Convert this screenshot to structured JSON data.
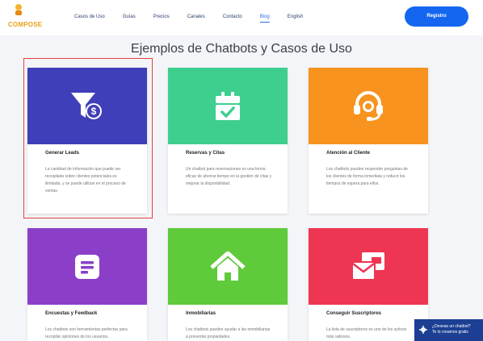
{
  "brand": {
    "name": "COMPOSE"
  },
  "nav": {
    "items": [
      {
        "label": "Casos de Uso",
        "active": false
      },
      {
        "label": "Guías",
        "active": false
      },
      {
        "label": "Precios",
        "active": false
      },
      {
        "label": "Canales",
        "active": false
      },
      {
        "label": "Contacto",
        "active": false
      },
      {
        "label": "Blog",
        "active": true
      },
      {
        "label": "English",
        "active": false
      }
    ],
    "cta_label": "Registro"
  },
  "section": {
    "title": "Ejemplos de Chatbots y Casos de Uso"
  },
  "cards": [
    {
      "title": "Generar Leads",
      "text": "La cantidad de información que puede ser recopilada sobre clientes potenciales es ilimitada, y se puede utilizar en el proceso de ventas.",
      "color": "#3f3fb9",
      "icon": "funnel-dollar-icon"
    },
    {
      "title": "Reservas y Citas",
      "text": "Un chatbot para reservaciones es una forma eficaz de ahorrar tiempo en la gestión de citas y mejorar la disponibilidad.",
      "color": "#3ecf8e",
      "icon": "calendar-check-icon"
    },
    {
      "title": "Atención al Cliente",
      "text": "Los chatbots pueden responder preguntas de los clientes de forma inmediata y reducir los tiempos de espera para ellos.",
      "color": "#f7931e",
      "icon": "headset-icon"
    },
    {
      "title": "Encuestas y Feedback",
      "text": "Los chatbots son herramientas perfectas para recopilar opiniones de los usuarios.",
      "color": "#8b3fc9",
      "icon": "form-icon"
    },
    {
      "title": "Inmobiliarias",
      "text": "Los chatbots pueden ayudar a las inmobiliarias a presentar propiedades.",
      "color": "#5fca3a",
      "icon": "house-icon"
    },
    {
      "title": "Conseguir Suscriptores",
      "text": "La lista de suscriptores es uno de los activos más valiosos.",
      "color": "#ee3552",
      "icon": "envelopes-icon"
    }
  ],
  "chat": {
    "line1": "¿Deseas un chatbot?",
    "line2": "Te lo creamos gratis"
  }
}
